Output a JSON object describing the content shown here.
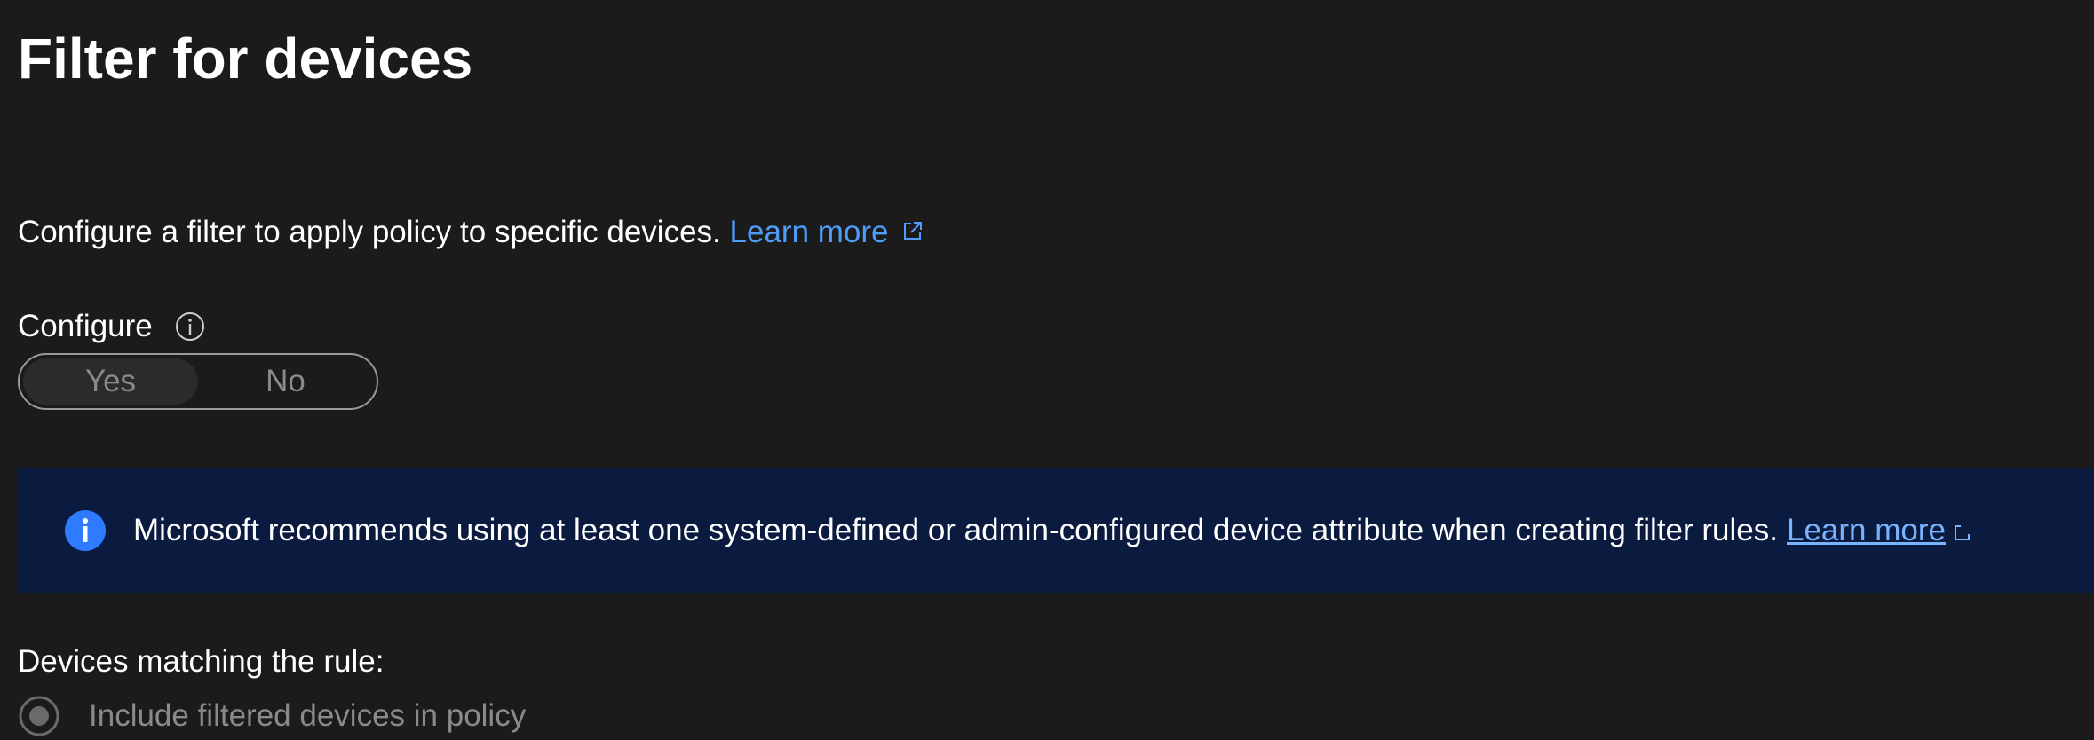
{
  "page": {
    "title": "Filter for devices"
  },
  "description": {
    "text": "Configure a filter to apply policy to specific devices.",
    "link_label": "Learn more",
    "link_icon": "external-link-icon"
  },
  "configure": {
    "label": "Configure",
    "info_icon": "info-icon",
    "options": [
      {
        "label": "Yes",
        "selected": true
      },
      {
        "label": "No",
        "selected": false
      }
    ]
  },
  "banner": {
    "icon": "info-filled-icon",
    "text": "Microsoft recommends using at least one system-defined or admin-configured device attribute when creating filter rules.",
    "link_label": "Learn more",
    "link_icon": "external-link-icon",
    "background": "#0b1a3f",
    "icon_color": "#2f7bff"
  },
  "devices_rule": {
    "label": "Devices matching the rule:",
    "options": [
      {
        "label": "Include filtered devices in policy",
        "selected": true
      }
    ]
  },
  "colors": {
    "background": "#1b1b1b",
    "link": "#4f9cf9",
    "disabled_text": "#8a8a8a"
  }
}
